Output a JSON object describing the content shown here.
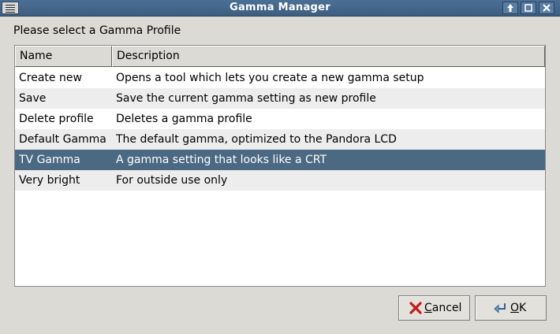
{
  "window": {
    "title": "Gamma Manager",
    "buttons": {
      "maximize_glyph": "⬆",
      "restore_glyph": "▫",
      "close_glyph": "✕"
    }
  },
  "prompt": "Please select a Gamma Profile",
  "table": {
    "columns": [
      "Name",
      "Description"
    ],
    "rows": [
      {
        "name": "Create new",
        "description": "Opens a tool which lets you create a new gamma setup"
      },
      {
        "name": "Save",
        "description": "Save the current gamma setting as new profile"
      },
      {
        "name": "Delete profile",
        "description": "Deletes a gamma profile"
      },
      {
        "name": "Default Gamma",
        "description": "The default gamma, optimized to the Pandora LCD"
      },
      {
        "name": "TV Gamma",
        "description": "A gamma setting that looks like a CRT"
      },
      {
        "name": "Very bright",
        "description": "For outside use only"
      }
    ],
    "selected_index": 4
  },
  "buttons": {
    "cancel": {
      "mnemonic": "C",
      "rest": "ancel",
      "icon": "cancel-x-icon"
    },
    "ok": {
      "mnemonic": "O",
      "rest": "K",
      "icon": "ok-arrow-icon"
    }
  },
  "colors": {
    "titlebar": "#4b6f95",
    "selection": "#4b6983",
    "window_bg": "#dcdad5",
    "cancel_icon": "#c41a1a"
  }
}
